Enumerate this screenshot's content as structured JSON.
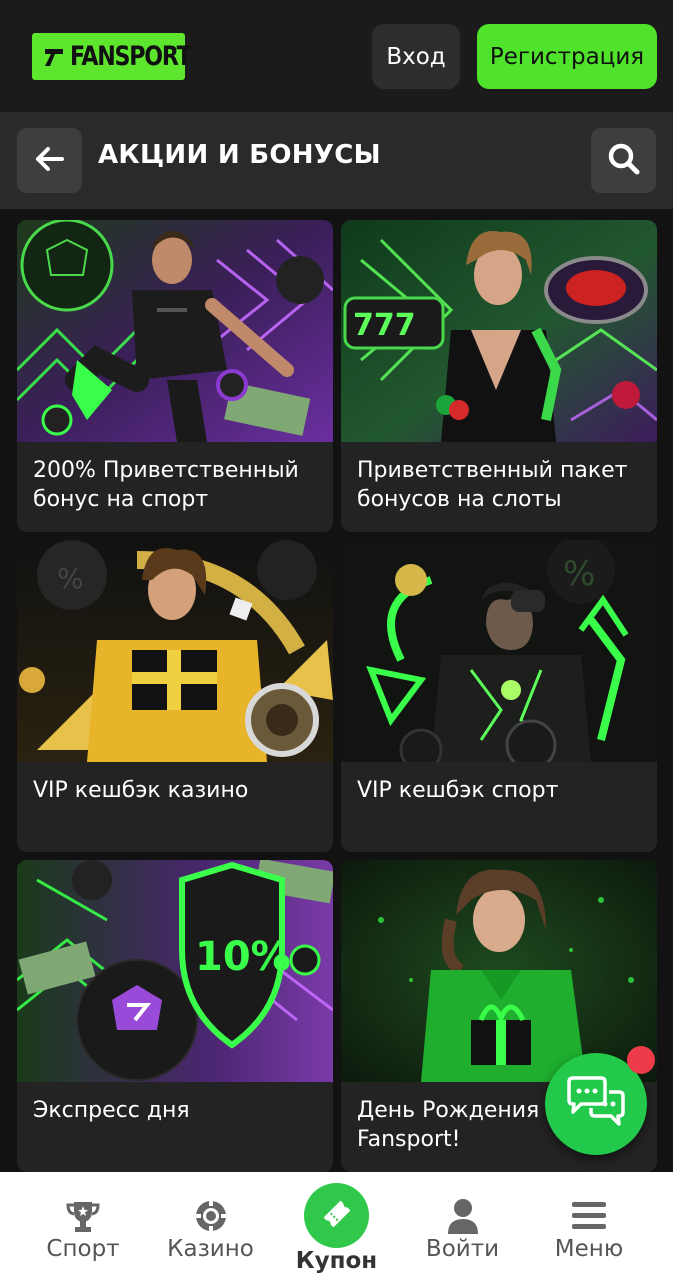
{
  "header": {
    "logo_text": "FANSPORT",
    "login_label": "Вход",
    "register_label": "Регистрация"
  },
  "page": {
    "title": "АКЦИИ И БОНУСЫ",
    "back_icon": "arrow-left-icon",
    "search_icon": "search-icon"
  },
  "promos": [
    {
      "title": "200% Приветственный бонус на спорт",
      "image": "football-player-promo-image"
    },
    {
      "title": "Приветственный пакет бонусов на слоты",
      "image": "slots-woman-promo-image"
    },
    {
      "title": "VIP кешбэк казино",
      "image": "casino-cashback-promo-image"
    },
    {
      "title": "VIP кешбэк спорт",
      "image": "sport-cashback-promo-image"
    },
    {
      "title": "Экспресс дня",
      "image": "express-ball-shield-promo-image"
    },
    {
      "title": "День Рождения Fansport!",
      "image": "birthday-gift-promo-image"
    }
  ],
  "promo_badge": "10%",
  "chat": {
    "icon": "chat-bubbles-icon",
    "has_notification": true
  },
  "bottom_nav": [
    {
      "label": "Спорт",
      "icon": "trophy-icon"
    },
    {
      "label": "Казино",
      "icon": "casino-chip-icon"
    },
    {
      "label": "Купон",
      "icon": "ticket-icon"
    },
    {
      "label": "Войти",
      "icon": "user-icon"
    },
    {
      "label": "Меню",
      "icon": "menu-icon"
    }
  ],
  "colors": {
    "brand_green": "#4fe32b",
    "background": "#121212",
    "card": "#232323",
    "notification": "#ee3b4a"
  }
}
